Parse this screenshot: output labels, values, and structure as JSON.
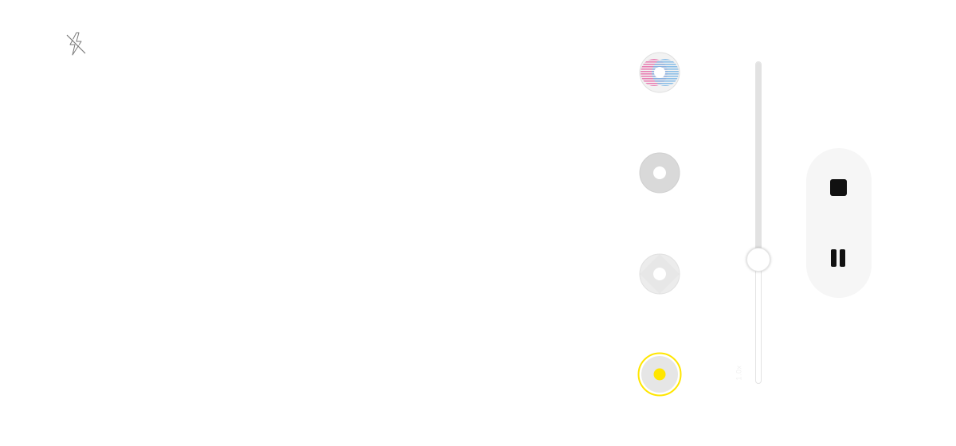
{
  "camera": {
    "flash": {
      "icon": "flash-off-icon",
      "state": "off"
    },
    "modes": [
      {
        "name": "color",
        "icon": "color-filter-icon",
        "selected": false
      },
      {
        "name": "gray",
        "icon": "gray-filter-icon",
        "selected": false
      },
      {
        "name": "light",
        "icon": "light-filter-icon",
        "selected": false
      },
      {
        "name": "yellow",
        "icon": "yellow-filter-icon",
        "selected": true,
        "accent": "#ffe600"
      }
    ],
    "zoom": {
      "label": "1.0x",
      "level": 0.38
    },
    "recording_controls": {
      "stop_icon": "stop-icon",
      "pause_icon": "pause-icon"
    }
  }
}
